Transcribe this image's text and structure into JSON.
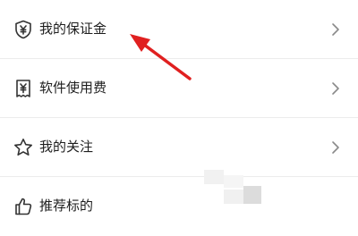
{
  "menu": {
    "items": [
      {
        "label": "我的保证金",
        "icon": "shield-yen-icon"
      },
      {
        "label": "软件使用费",
        "icon": "receipt-yen-icon"
      },
      {
        "label": "我的关注",
        "icon": "star-icon"
      },
      {
        "label": "推荐标的",
        "icon": "thumbs-up-icon"
      }
    ]
  },
  "colors": {
    "annotation_arrow": "#e02020",
    "text": "#1e1e1e",
    "divider": "#ececec",
    "chevron": "#8a8a8a"
  }
}
